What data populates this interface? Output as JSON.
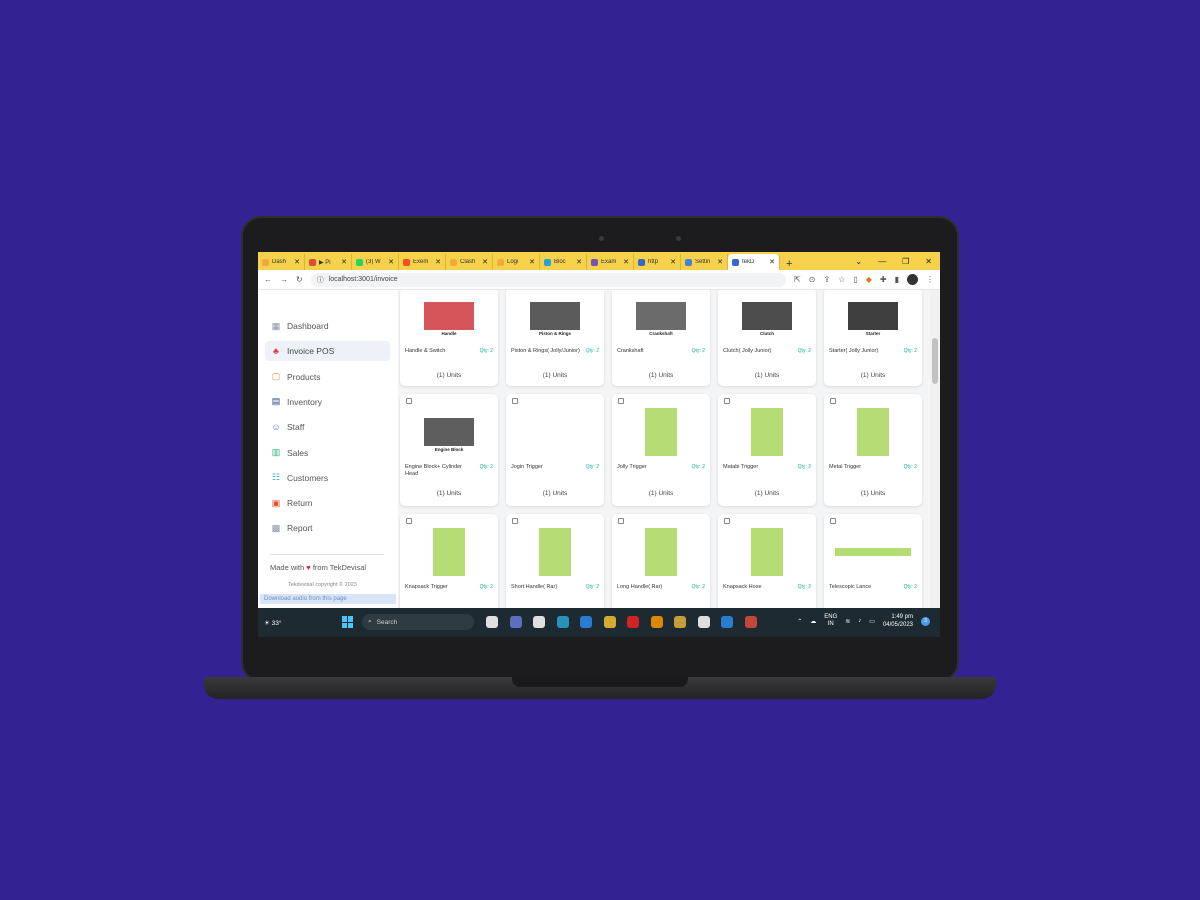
{
  "browser": {
    "tabs": [
      {
        "label": "Dash",
        "color": "#f2a93b"
      },
      {
        "label": "▶ Pi",
        "color": "#e24a3b"
      },
      {
        "label": "(3) W",
        "color": "#25d366"
      },
      {
        "label": "Exem",
        "color": "#f24e1e"
      },
      {
        "label": "Clash",
        "color": "#f2a93b"
      },
      {
        "label": "Logi",
        "color": "#f2a93b"
      },
      {
        "label": "Bloc",
        "color": "#2aa3d5"
      },
      {
        "label": "Exam",
        "color": "#7952b3"
      },
      {
        "label": "http",
        "color": "#3767c8"
      },
      {
        "label": "Settin",
        "color": "#4a7fd8"
      },
      {
        "label": "tekD",
        "color": "#3767c8"
      }
    ],
    "new_tab": "+",
    "url": "localhost:3001/invoice"
  },
  "sidebar": {
    "items": [
      {
        "label": "Dashboard",
        "icon": "dashboard-icon",
        "glyph": "▦",
        "color": "#8a8fa8"
      },
      {
        "label": "Invoice POS",
        "icon": "pos-icon",
        "glyph": "♣",
        "color": "#e2383f"
      },
      {
        "label": "Products",
        "icon": "products-icon",
        "glyph": "▢",
        "color": "#f08a3c"
      },
      {
        "label": "Inventory",
        "icon": "inventory-icon",
        "glyph": "▤",
        "color": "#2a3b7c"
      },
      {
        "label": "Staff",
        "icon": "staff-icon",
        "glyph": "☺",
        "color": "#4f6ad8"
      },
      {
        "label": "Sales",
        "icon": "sales-icon",
        "glyph": "▥",
        "color": "#2cb67d"
      },
      {
        "label": "Customers",
        "icon": "customers-icon",
        "glyph": "☷",
        "color": "#3aa9d8"
      },
      {
        "label": "Return",
        "icon": "return-icon",
        "glyph": "▣",
        "color": "#e9502f"
      },
      {
        "label": "Report",
        "icon": "report-icon",
        "glyph": "▩",
        "color": "#8a8fa8"
      }
    ],
    "made_with_prefix": "Made with",
    "made_with_suffix": "from TekDevisal",
    "copyright": "Tekdevisal copyright © 2023",
    "download_bar": "Download audio from this page"
  },
  "products": [
    {
      "name": "Handle & Switch",
      "stock": "Qty: 2",
      "units": "(1) Units",
      "img_color": "#d6555a",
      "caption": "Handle"
    },
    {
      "name": "Piston & Rings( Jolly/Junior)",
      "stock": "Qty: 2",
      "units": "(1) Units",
      "img_color": "#5a5a5a",
      "caption": "Piston & Rings"
    },
    {
      "name": "Crankshaft",
      "stock": "Qty: 2",
      "units": "(1) Units",
      "img_color": "#6b6b6b",
      "caption": "Crankshaft"
    },
    {
      "name": "Clutch( Jolly Junior)",
      "stock": "Qty: 2",
      "units": "(1) Units",
      "img_color": "#4d4d4d",
      "caption": "Clutch"
    },
    {
      "name": "Starter( Jolly Junior)",
      "stock": "Qty: 2",
      "units": "(1) Units",
      "img_color": "#3f3f3f",
      "caption": "Starter"
    },
    {
      "name": "Engine Block+ Cylinder Head",
      "stock": "Qty: 2",
      "units": "(1) Units",
      "img_color": "#5e5e5e",
      "caption": "Engine Block"
    },
    {
      "name": "Jogin Trigger",
      "stock": "Qty: 2",
      "units": "(1) Units",
      "img_color": "#ffffff",
      "caption": ""
    },
    {
      "name": "Jolly Trigger",
      "stock": "Qty: 2",
      "units": "(1) Units",
      "img_color": "#b6dd75",
      "caption": ""
    },
    {
      "name": "Matabi Trigger",
      "stock": "Qty: 2",
      "units": "(1) Units",
      "img_color": "#b6dd75",
      "caption": ""
    },
    {
      "name": "Metal Trigger",
      "stock": "Qty: 2",
      "units": "(1) Units",
      "img_color": "#b6dd75",
      "caption": ""
    },
    {
      "name": "Knapsack Trigger",
      "stock": "Qty: 2",
      "units": "",
      "img_color": "#b6dd75",
      "caption": ""
    },
    {
      "name": "Short Handle( Rar)",
      "stock": "Qty: 2",
      "units": "",
      "img_color": "#b6dd75",
      "caption": ""
    },
    {
      "name": "Long Handle( Rar)",
      "stock": "Qty: 2",
      "units": "",
      "img_color": "#b6dd75",
      "caption": ""
    },
    {
      "name": "Knapsack Hose",
      "stock": "Qty: 2",
      "units": "",
      "img_color": "#b6dd75",
      "caption": ""
    },
    {
      "name": "Telescopic Lance",
      "stock": "Qty: 2",
      "units": "",
      "img_color": "#b6dd75",
      "caption": ""
    }
  ],
  "taskbar": {
    "weather": "33°",
    "search": "Search",
    "lang_1": "ENG",
    "lang_2": "IN",
    "time": "1:49 pm",
    "date": "04/05/2023",
    "notif_count": "3",
    "apps": [
      "#ffffff",
      "#6b7bd8",
      "#ffffff",
      "#2aa3d5",
      "#2a8cf0",
      "#f2c230",
      "#e22",
      "#ff9900",
      "#e2b340",
      "#ffffff",
      "#2a8cf0",
      "#e24a3b"
    ]
  }
}
